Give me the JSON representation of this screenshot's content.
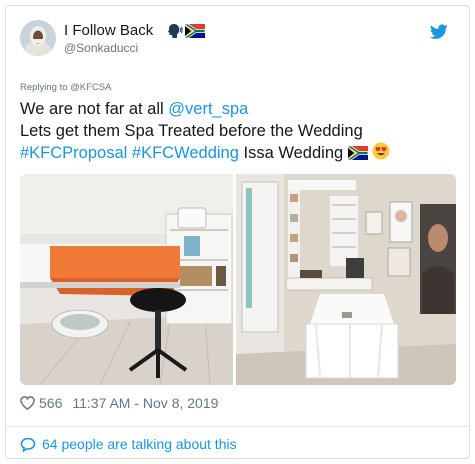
{
  "tweet": {
    "display_name": "I Follow Back",
    "handle": "@Sonkaducci",
    "replying_to": "Replying to @KFCSA",
    "line1_text": "We are not far at all ",
    "line1_mention": "@vert_spa",
    "line2_text": "Lets get them Spa Treated before the Wedding",
    "hashtag1": "#KFCProposal",
    "hashtag2": "#KFCWedding",
    "line3_text": " Issa Wedding ",
    "likes": "566",
    "timestamp": "11:37 AM - Nov 8, 2019",
    "talking": "64 people are talking about this"
  },
  "icons": {
    "name_emoji": "speaking-head-icon",
    "flag": "south-africa-flag-icon",
    "face": "heart-eyes-emoji-icon",
    "platform": "twitter-bird-icon",
    "like": "heart-outline-icon",
    "reply": "speech-bubble-icon"
  },
  "colors": {
    "link": "#1b95e0",
    "secondary_text": "#657786",
    "primary_text": "#14171a",
    "towel": "#f07a38"
  }
}
